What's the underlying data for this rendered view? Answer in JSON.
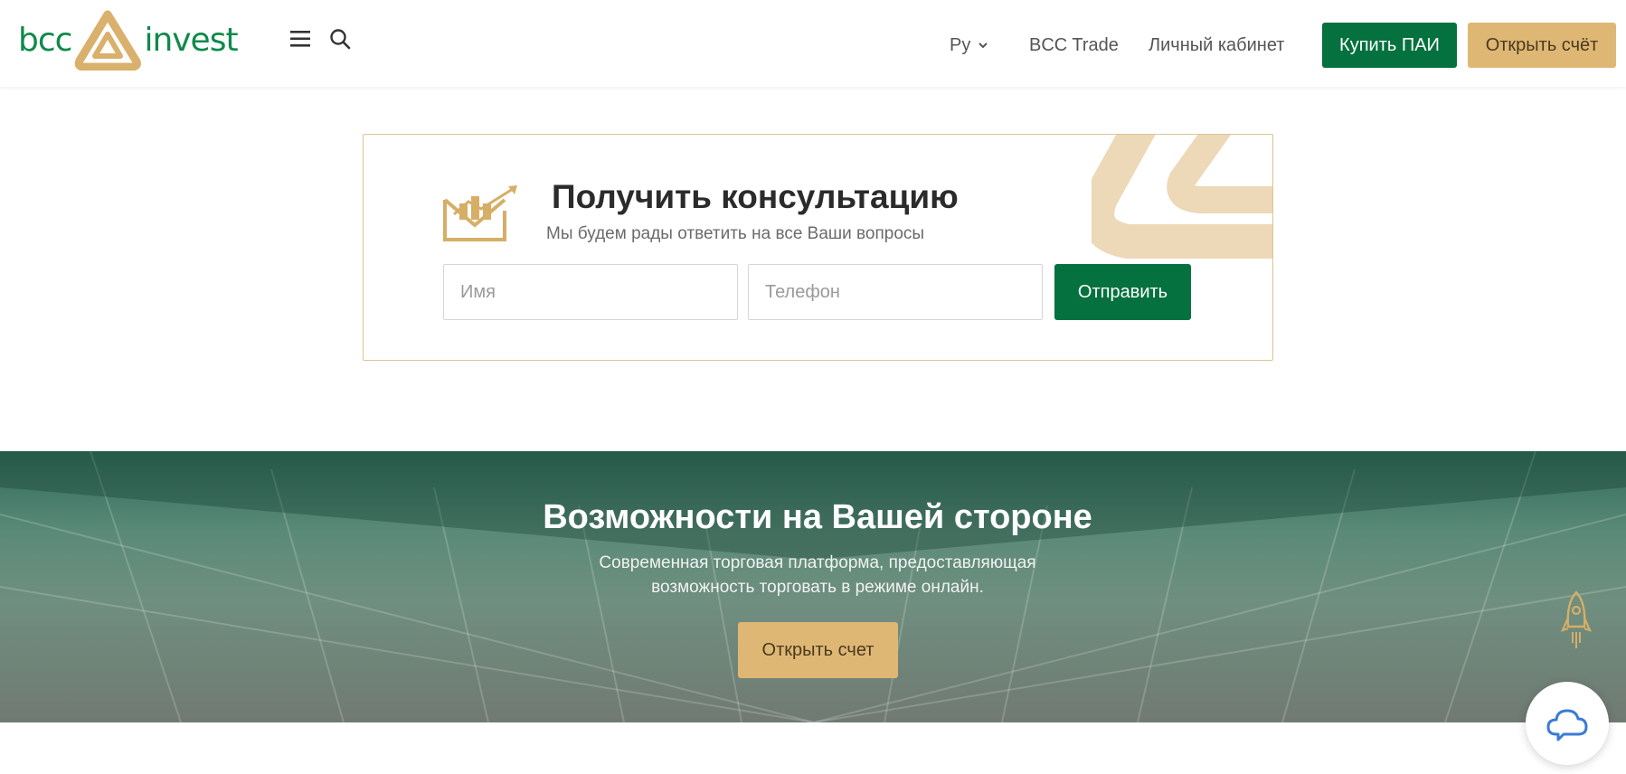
{
  "header": {
    "logo": {
      "left_text": "bcc",
      "right_text": "invest",
      "mark_icon": "triangle-logo-mark",
      "text_color": "#0f8a4a",
      "mark_color": "#d9b06c"
    },
    "menu_icon": "hamburger-icon",
    "search_icon": "search-icon",
    "language": {
      "label": "Ру",
      "icon": "chevron-down-icon"
    },
    "nav": {
      "trade": "BCC Trade",
      "cabinet": "Личный кабинет"
    },
    "buttons": {
      "buy": "Купить ПАИ",
      "open_account": "Открыть счёт"
    }
  },
  "consultation": {
    "icon": "envelope-chart-icon",
    "title": "Получить консультацию",
    "subtitle": "Мы будем рады ответить на все Ваши вопросы",
    "name_placeholder": "Имя",
    "phone_placeholder": "Телефон",
    "submit_label": "Отправить"
  },
  "hero": {
    "title": "Возможности на Вашей стороне",
    "subtitle_line1": "Современная торговая платформа, предоставляющая",
    "subtitle_line2": "возможность торговать в режиме онлайн.",
    "button_label": "Открыть счет"
  },
  "floating": {
    "rocket_icon": "rocket-icon",
    "chat_icon": "cloud-chat-icon"
  },
  "colors": {
    "brand_green": "#05713f",
    "brand_gold": "#dfb774",
    "card_border": "#dcc592"
  }
}
